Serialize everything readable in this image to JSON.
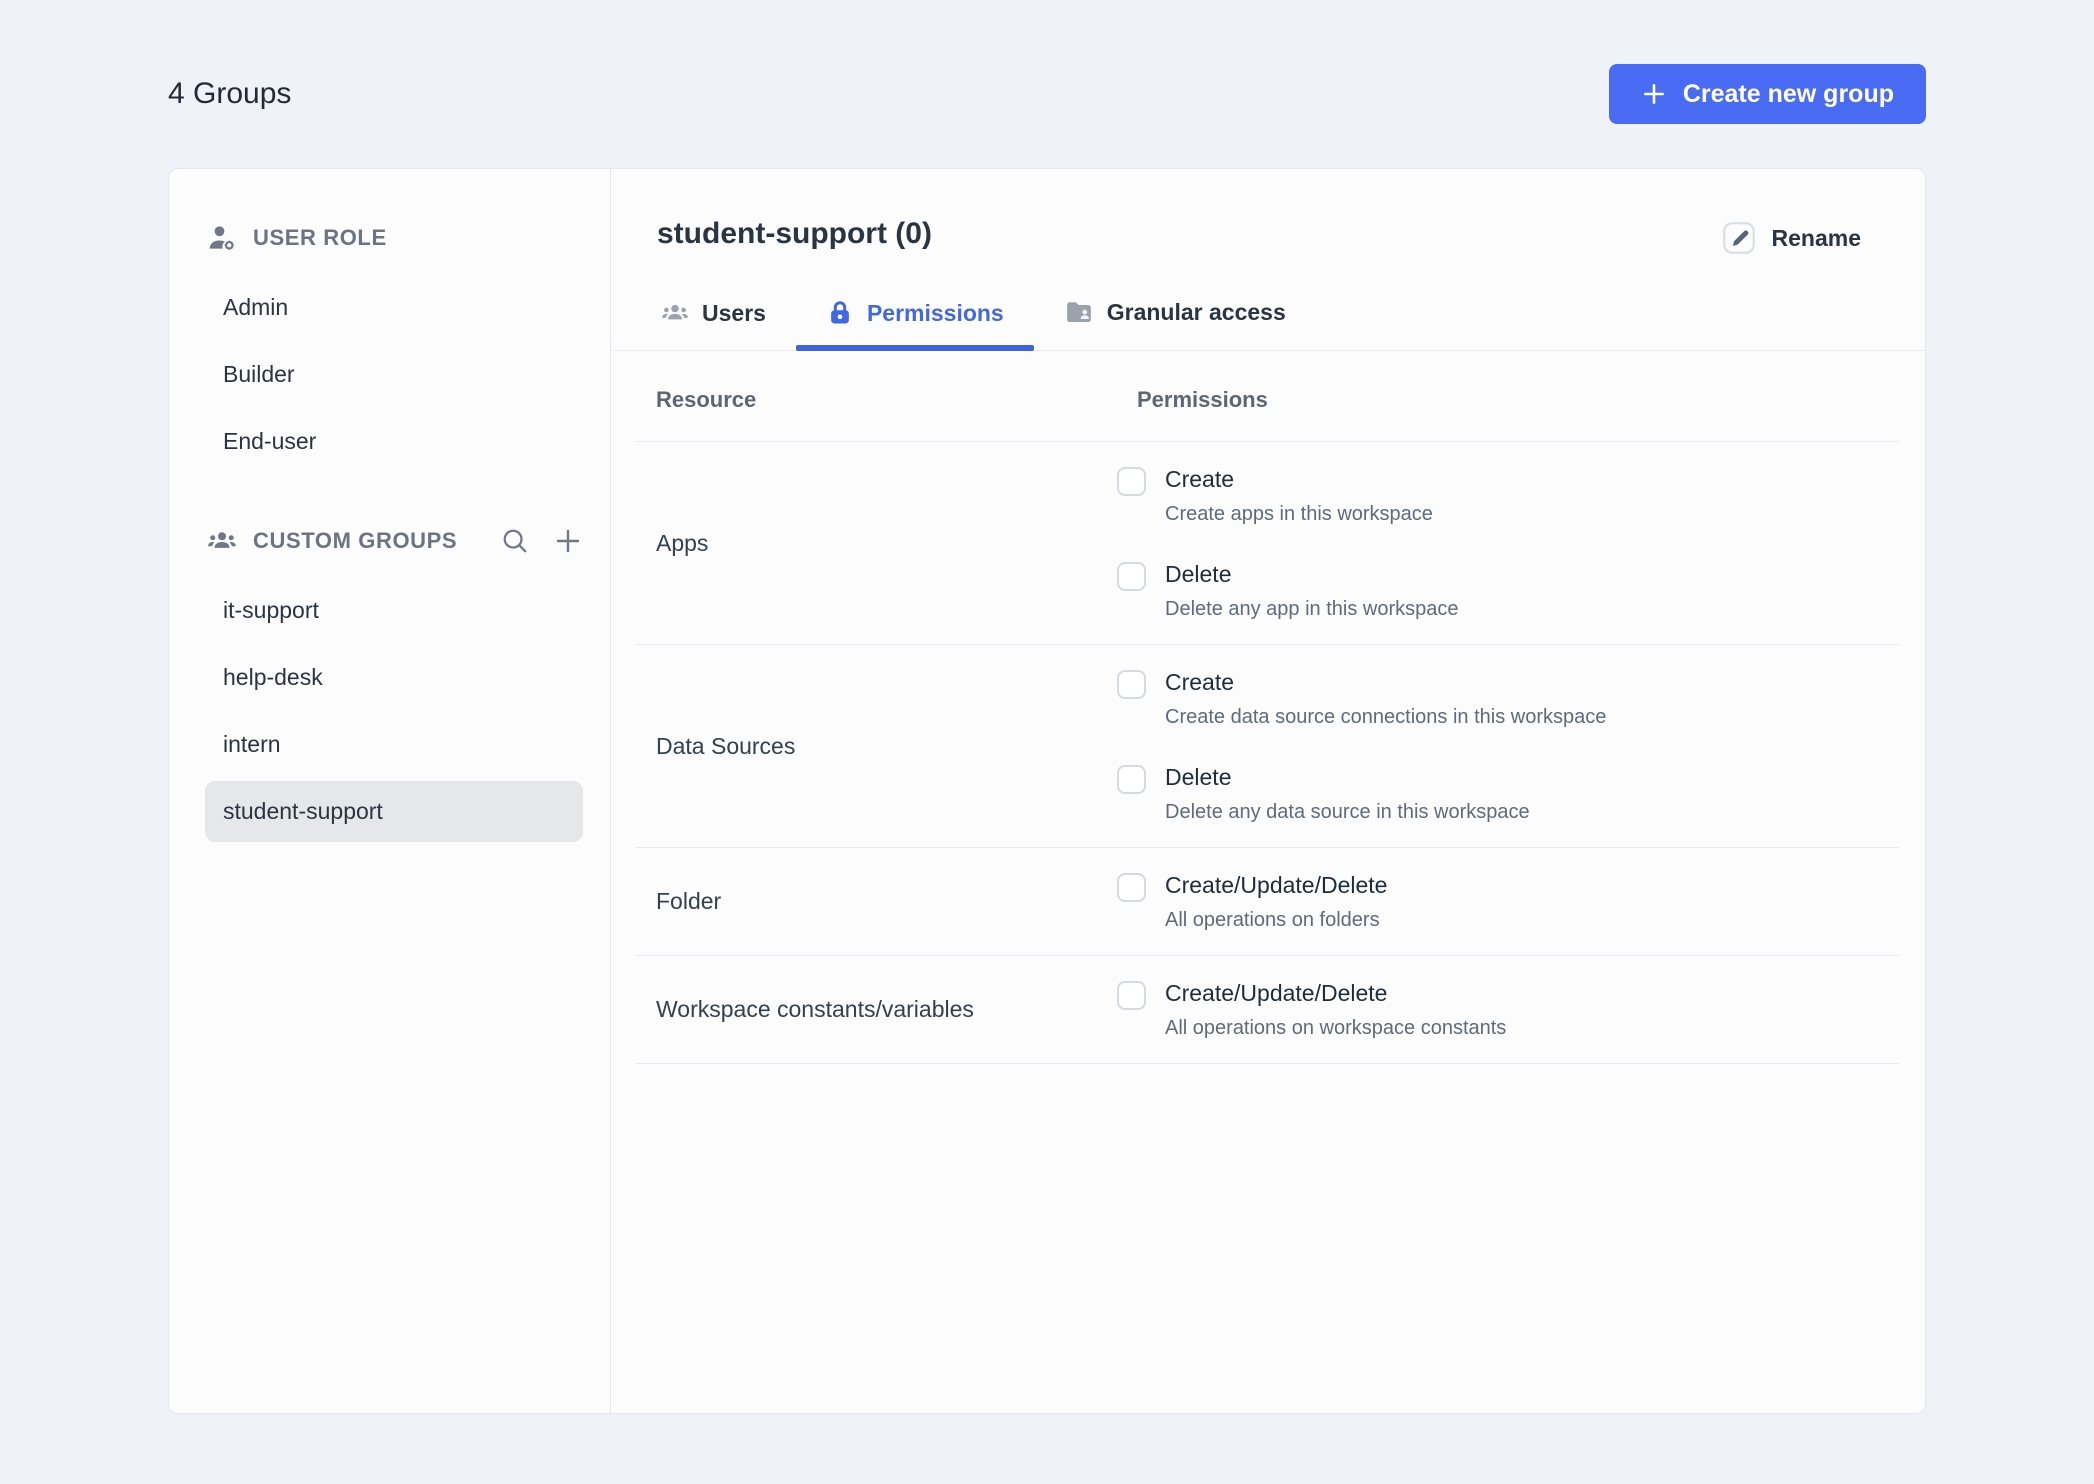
{
  "page": {
    "title": "4 Groups",
    "create_button_label": "Create new group"
  },
  "sidebar": {
    "user_role": {
      "title": "USER ROLE",
      "items": [
        "Admin",
        "Builder",
        "End-user"
      ]
    },
    "custom_groups": {
      "title": "CUSTOM GROUPS",
      "items": [
        "it-support",
        "help-desk",
        "intern",
        "student-support"
      ],
      "selected": "student-support"
    }
  },
  "main": {
    "title": "student-support (0)",
    "rename_label": "Rename",
    "tabs": [
      {
        "label": "Users",
        "icon": "users-icon",
        "active": false
      },
      {
        "label": "Permissions",
        "icon": "lock-icon",
        "active": true
      },
      {
        "label": "Granular access",
        "icon": "folder-user-icon",
        "active": false
      }
    ],
    "table": {
      "columns": [
        "Resource",
        "Permissions"
      ],
      "rows": [
        {
          "resource": "Apps",
          "permissions": [
            {
              "label": "Create",
              "description": "Create apps in this workspace",
              "checked": false
            },
            {
              "label": "Delete",
              "description": "Delete any app in this workspace",
              "checked": false
            }
          ]
        },
        {
          "resource": "Data Sources",
          "permissions": [
            {
              "label": "Create",
              "description": "Create data source connections in this workspace",
              "checked": false
            },
            {
              "label": "Delete",
              "description": "Delete any data source in this workspace",
              "checked": false
            }
          ]
        },
        {
          "resource": "Folder",
          "permissions": [
            {
              "label": "Create/Update/Delete",
              "description": "All operations on folders",
              "checked": false
            }
          ]
        },
        {
          "resource": "Workspace constants/variables",
          "permissions": [
            {
              "label": "Create/Update/Delete",
              "description": "All operations on workspace constants",
              "checked": false
            }
          ]
        }
      ]
    }
  },
  "colors": {
    "accent_button": "#4a6cf5",
    "tab_active": "#3e63dd",
    "page_background": "#eff3f8",
    "selected_item_background": "#e5e7ea",
    "divider": "#e9ecf0"
  }
}
